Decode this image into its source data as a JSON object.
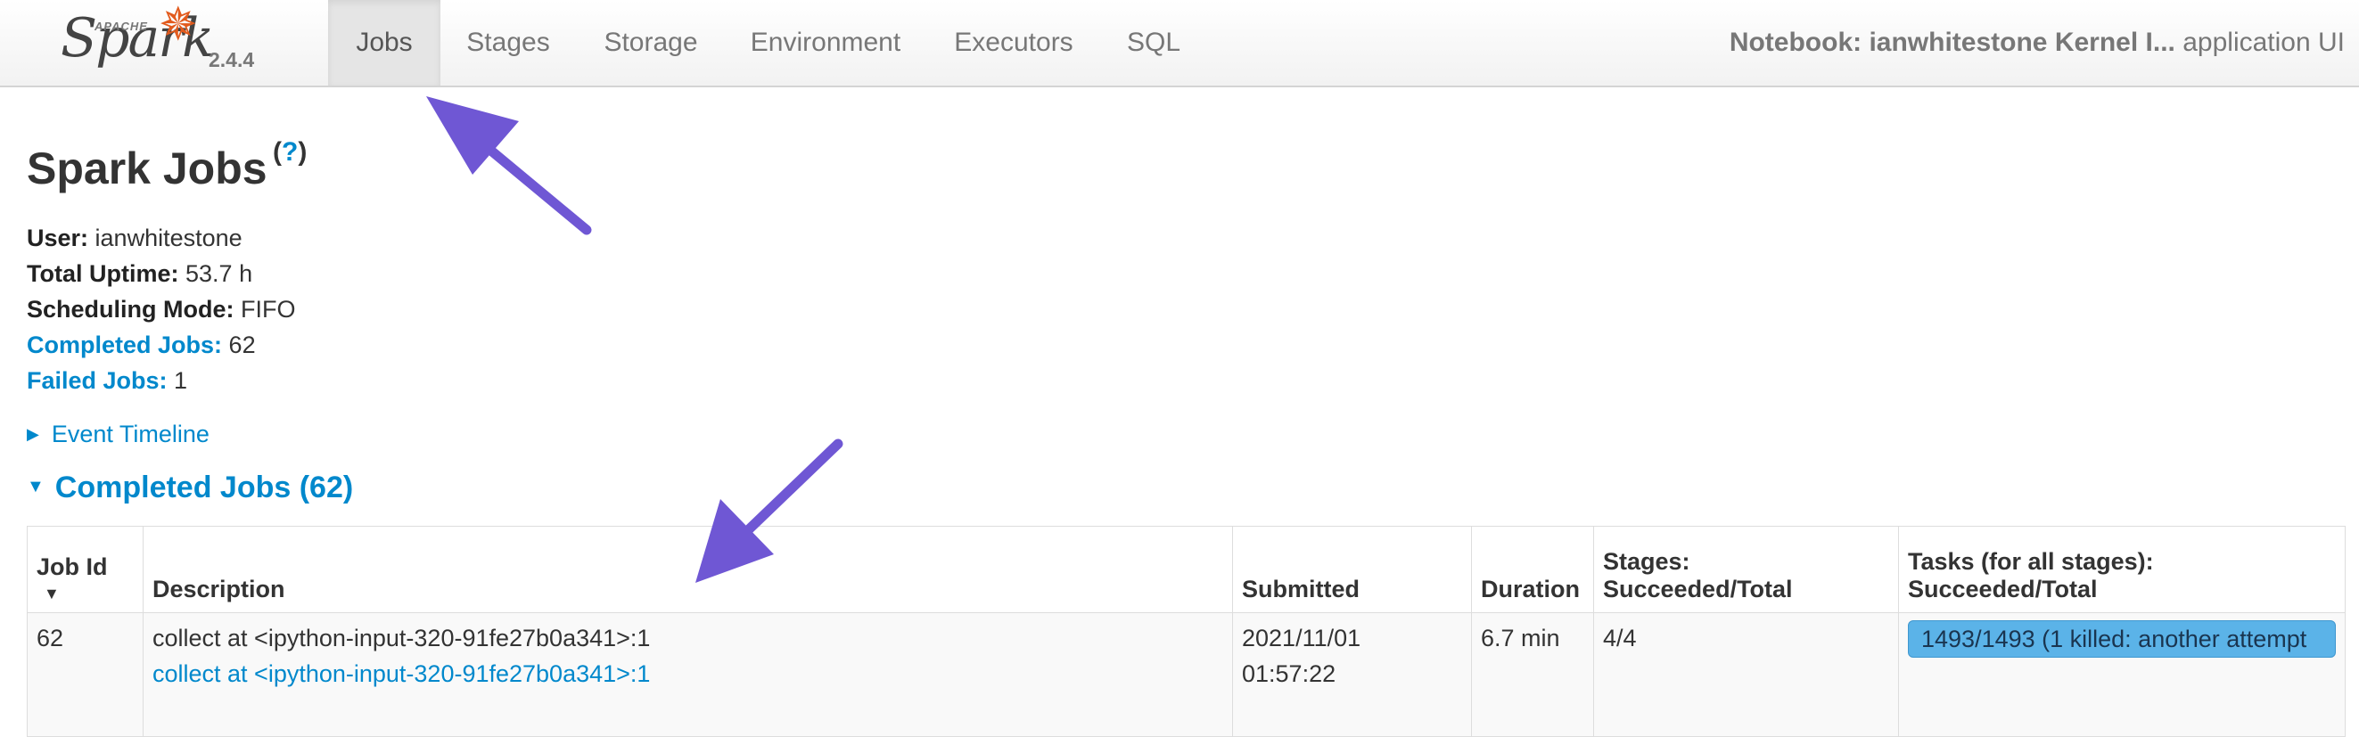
{
  "brand": {
    "apache": "APACHE",
    "name": "Spark",
    "version": "2.4.4"
  },
  "nav": {
    "tabs": [
      "Jobs",
      "Stages",
      "Storage",
      "Environment",
      "Executors",
      "SQL"
    ],
    "active": "Jobs",
    "app_name": "Notebook: ianwhitestone Kernel I...",
    "app_suffix": "application UI"
  },
  "page": {
    "title": "Spark Jobs",
    "help": "?"
  },
  "summary": {
    "user_label": "User:",
    "user": "ianwhitestone",
    "uptime_label": "Total Uptime:",
    "uptime": "53.7 h",
    "mode_label": "Scheduling Mode:",
    "mode": "FIFO",
    "completed_label": "Completed Jobs:",
    "completed": "62",
    "failed_label": "Failed Jobs:",
    "failed": "1"
  },
  "event_timeline": "Event Timeline",
  "completed_section": "Completed Jobs (62)",
  "table": {
    "headers": {
      "job_id": "Job Id",
      "description": "Description",
      "submitted": "Submitted",
      "duration": "Duration",
      "stages_1": "Stages:",
      "stages_2": "Succeeded/Total",
      "tasks_1": "Tasks (for all stages):",
      "tasks_2": "Succeeded/Total"
    },
    "rows": [
      {
        "job_id": "62",
        "description": "collect at <ipython-input-320-91fe27b0a341>:1",
        "description_link": "collect at <ipython-input-320-91fe27b0a341>:1",
        "submitted_date": "2021/11/01",
        "submitted_time": "01:57:22",
        "duration": "6.7 min",
        "stages": "4/4",
        "tasks": "1493/1493 (1 killed: another attempt",
        "tasks_progress": 1.0
      }
    ]
  },
  "colors": {
    "link": "#0088cc",
    "progress": "#5bb3e8",
    "annotation_arrow": "#6f57d4",
    "spark_star": "#e25a1c"
  }
}
